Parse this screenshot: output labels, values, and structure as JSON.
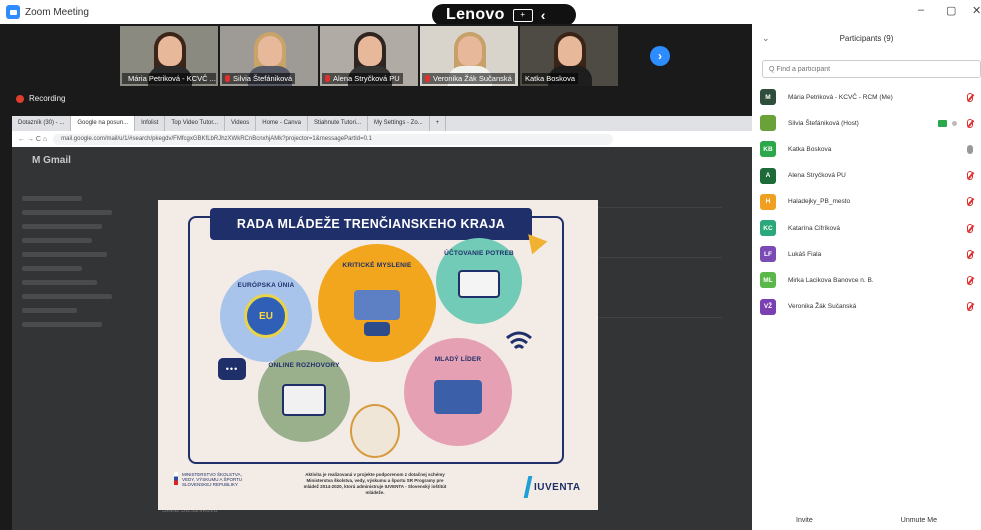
{
  "titlebar": {
    "app_title": "Zoom Meeting",
    "minimize": "–",
    "maximize": "▢",
    "close": "✕"
  },
  "lenovo_bar": {
    "brand": "Lenovo",
    "grid_icon": "+",
    "back_icon": "‹"
  },
  "video_strip": {
    "thumbnails": [
      {
        "name": "Mária Petriková - KCVČ ...",
        "hair": "#3b2418",
        "body": "#2a2a2a",
        "room": "#8a8a80"
      },
      {
        "name": "Silvia Štefániková",
        "hair": "#c9a46a",
        "body": "#555a66",
        "room": "#9e9a95"
      },
      {
        "name": "Alena Stryčková PU",
        "hair": "#2e2420",
        "body": "#333",
        "room": "#b0aba5"
      },
      {
        "name": "Veronika Žák Sučanská",
        "hair": "#c8a06a",
        "body": "#f1f1ee",
        "room": "#d8d4cc"
      },
      {
        "name": "Katka Boskova",
        "hair": "#3a2418",
        "body": "#1e1e1e",
        "room": "#4e4a44"
      }
    ],
    "active_index": 3,
    "next_icon": "›"
  },
  "recording": {
    "label": "Recording"
  },
  "browser": {
    "tabs": [
      "Dotazník (30) - ...",
      "Google na posun...",
      "Infolist",
      "Top Video Tutor...",
      "Videos",
      "Home - Canva",
      "Stiahnute Tutori...",
      "My Settings - Zo...",
      "+"
    ],
    "active_tab": 1,
    "nav_icons": "←  →  C  ⌂",
    "address": "mail.google.com/mail/u/1/#search/pkegdv/FMfcgxGBKfLbRJhzXWkRCnBcnxhjAMk?projector=1&messagePartId=0.1",
    "gmail_logo": "M Gmail",
    "gmail_footer": "Silvia Štefániková"
  },
  "slide": {
    "title": "RADA MLÁDEŽE TRENČIANSKEHO KRAJA",
    "bubbles": {
      "eu": "EURÓPSKA ÚNIA",
      "critical": "KRITICKÉ MYSLENIE",
      "finance": "ÚČTOVANIE POTREB",
      "online": "ONLINE ROZHOVORY",
      "leader": "MLADÝ LÍDER"
    },
    "eu_text": "EU",
    "chat_glyph": "•••",
    "ministry": "MINISTERSTVO ŠKOLSTVA, VEDY, VÝSKUMU A ŠPORTU SLOVENSKEJ REPUBLIKY",
    "footer_text": "Aktivita je realizovaná v projekte podporenom z dotačnej schémy Ministerstva školstva, vedy, výskumu a športu SR Programy pre mládež 2014-2020, ktorú administruje IUVENTA - Slovenský inštitút mládeže.",
    "iuventa": "IUVENTA"
  },
  "participants_panel": {
    "collapse_icon": "⌄",
    "title": "Participants (9)",
    "search_placeholder": "Q Find a participant",
    "participants": [
      {
        "initials": "M",
        "color": "#2e4d3a",
        "name": "Mária Petriková - KCVČ - RCM (Me)",
        "mic": "muted"
      },
      {
        "initials": "",
        "color": "#6aa23a",
        "name": "Silvia Štefániková (Host)",
        "mic": "muted",
        "camera": true
      },
      {
        "initials": "KB",
        "color": "#2aa84a",
        "name": "Katka Boskova",
        "mic": "on"
      },
      {
        "initials": "A",
        "color": "#1e6b3a",
        "name": "Alena Stryčková PU",
        "mic": "muted"
      },
      {
        "initials": "H",
        "color": "#f0a020",
        "name": "Haladejky_PB_mesto",
        "mic": "muted"
      },
      {
        "initials": "KC",
        "color": "#2aa87a",
        "name": "Katarína Cifríková",
        "mic": "muted"
      },
      {
        "initials": "LF",
        "color": "#7b4bb5",
        "name": "Lukáš Fiala",
        "mic": "muted"
      },
      {
        "initials": "ML",
        "color": "#5ab84a",
        "name": "Mirka Lacikova Banovce n. B.",
        "mic": "muted"
      },
      {
        "initials": "VŽ",
        "color": "#7a3fb0",
        "name": "Veronika Žák Sučanská",
        "mic": "muted"
      }
    ],
    "invite": "Invite",
    "unmute": "Unmute Me"
  }
}
